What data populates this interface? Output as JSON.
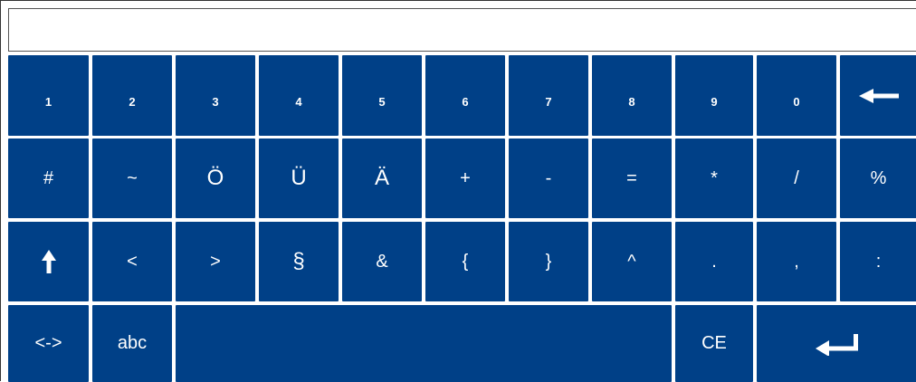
{
  "input": {
    "value": ""
  },
  "colors": {
    "key_bg": "#004087",
    "key_text": "#ffffff",
    "background": "#ffffff"
  },
  "rows": {
    "r1": [
      "1",
      "2",
      "3",
      "4",
      "5",
      "6",
      "7",
      "8",
      "9",
      "0"
    ],
    "r2": [
      "#",
      "~",
      "Ö",
      "Ü",
      "Ä",
      "+",
      "-",
      "=",
      "*",
      "/",
      "%"
    ],
    "r3": [
      "<",
      ">",
      "§",
      "&",
      "{",
      "}",
      "^",
      ".",
      ",",
      ":"
    ],
    "r4": {
      "toggle": "<->",
      "abc": "abc",
      "ce": "CE"
    }
  },
  "icons": {
    "backspace": "arrow-left-icon",
    "shift": "arrow-up-icon",
    "enter": "enter-return-icon"
  }
}
